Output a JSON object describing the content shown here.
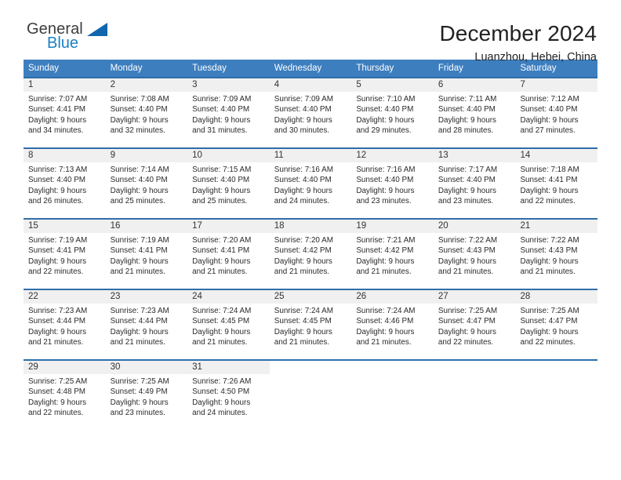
{
  "brand": {
    "name_part1": "General",
    "name_part2": "Blue",
    "triangle_icon": "triangle-icon",
    "color_dark": "#3c3c3c",
    "color_blue": "#1c7fc4",
    "triangle_color": "#1167ad"
  },
  "header": {
    "title": "December 2024",
    "subtitle": "Luanzhou, Hebei, China"
  },
  "theme": {
    "header_bg": "#3d7ebf",
    "header_text": "#ffffff",
    "row_separator": "#2f6ea8",
    "daynum_bg": "#f0f0f0",
    "body_text": "#2b2b2b"
  },
  "weekdays": [
    "Sunday",
    "Monday",
    "Tuesday",
    "Wednesday",
    "Thursday",
    "Friday",
    "Saturday"
  ],
  "weeks": [
    [
      {
        "day": "1",
        "sunrise": "Sunrise: 7:07 AM",
        "sunset": "Sunset: 4:41 PM",
        "daylight_line1": "Daylight: 9 hours",
        "daylight_line2": "and 34 minutes."
      },
      {
        "day": "2",
        "sunrise": "Sunrise: 7:08 AM",
        "sunset": "Sunset: 4:40 PM",
        "daylight_line1": "Daylight: 9 hours",
        "daylight_line2": "and 32 minutes."
      },
      {
        "day": "3",
        "sunrise": "Sunrise: 7:09 AM",
        "sunset": "Sunset: 4:40 PM",
        "daylight_line1": "Daylight: 9 hours",
        "daylight_line2": "and 31 minutes."
      },
      {
        "day": "4",
        "sunrise": "Sunrise: 7:09 AM",
        "sunset": "Sunset: 4:40 PM",
        "daylight_line1": "Daylight: 9 hours",
        "daylight_line2": "and 30 minutes."
      },
      {
        "day": "5",
        "sunrise": "Sunrise: 7:10 AM",
        "sunset": "Sunset: 4:40 PM",
        "daylight_line1": "Daylight: 9 hours",
        "daylight_line2": "and 29 minutes."
      },
      {
        "day": "6",
        "sunrise": "Sunrise: 7:11 AM",
        "sunset": "Sunset: 4:40 PM",
        "daylight_line1": "Daylight: 9 hours",
        "daylight_line2": "and 28 minutes."
      },
      {
        "day": "7",
        "sunrise": "Sunrise: 7:12 AM",
        "sunset": "Sunset: 4:40 PM",
        "daylight_line1": "Daylight: 9 hours",
        "daylight_line2": "and 27 minutes."
      }
    ],
    [
      {
        "day": "8",
        "sunrise": "Sunrise: 7:13 AM",
        "sunset": "Sunset: 4:40 PM",
        "daylight_line1": "Daylight: 9 hours",
        "daylight_line2": "and 26 minutes."
      },
      {
        "day": "9",
        "sunrise": "Sunrise: 7:14 AM",
        "sunset": "Sunset: 4:40 PM",
        "daylight_line1": "Daylight: 9 hours",
        "daylight_line2": "and 25 minutes."
      },
      {
        "day": "10",
        "sunrise": "Sunrise: 7:15 AM",
        "sunset": "Sunset: 4:40 PM",
        "daylight_line1": "Daylight: 9 hours",
        "daylight_line2": "and 25 minutes."
      },
      {
        "day": "11",
        "sunrise": "Sunrise: 7:16 AM",
        "sunset": "Sunset: 4:40 PM",
        "daylight_line1": "Daylight: 9 hours",
        "daylight_line2": "and 24 minutes."
      },
      {
        "day": "12",
        "sunrise": "Sunrise: 7:16 AM",
        "sunset": "Sunset: 4:40 PM",
        "daylight_line1": "Daylight: 9 hours",
        "daylight_line2": "and 23 minutes."
      },
      {
        "day": "13",
        "sunrise": "Sunrise: 7:17 AM",
        "sunset": "Sunset: 4:40 PM",
        "daylight_line1": "Daylight: 9 hours",
        "daylight_line2": "and 23 minutes."
      },
      {
        "day": "14",
        "sunrise": "Sunrise: 7:18 AM",
        "sunset": "Sunset: 4:41 PM",
        "daylight_line1": "Daylight: 9 hours",
        "daylight_line2": "and 22 minutes."
      }
    ],
    [
      {
        "day": "15",
        "sunrise": "Sunrise: 7:19 AM",
        "sunset": "Sunset: 4:41 PM",
        "daylight_line1": "Daylight: 9 hours",
        "daylight_line2": "and 22 minutes."
      },
      {
        "day": "16",
        "sunrise": "Sunrise: 7:19 AM",
        "sunset": "Sunset: 4:41 PM",
        "daylight_line1": "Daylight: 9 hours",
        "daylight_line2": "and 21 minutes."
      },
      {
        "day": "17",
        "sunrise": "Sunrise: 7:20 AM",
        "sunset": "Sunset: 4:41 PM",
        "daylight_line1": "Daylight: 9 hours",
        "daylight_line2": "and 21 minutes."
      },
      {
        "day": "18",
        "sunrise": "Sunrise: 7:20 AM",
        "sunset": "Sunset: 4:42 PM",
        "daylight_line1": "Daylight: 9 hours",
        "daylight_line2": "and 21 minutes."
      },
      {
        "day": "19",
        "sunrise": "Sunrise: 7:21 AM",
        "sunset": "Sunset: 4:42 PM",
        "daylight_line1": "Daylight: 9 hours",
        "daylight_line2": "and 21 minutes."
      },
      {
        "day": "20",
        "sunrise": "Sunrise: 7:22 AM",
        "sunset": "Sunset: 4:43 PM",
        "daylight_line1": "Daylight: 9 hours",
        "daylight_line2": "and 21 minutes."
      },
      {
        "day": "21",
        "sunrise": "Sunrise: 7:22 AM",
        "sunset": "Sunset: 4:43 PM",
        "daylight_line1": "Daylight: 9 hours",
        "daylight_line2": "and 21 minutes."
      }
    ],
    [
      {
        "day": "22",
        "sunrise": "Sunrise: 7:23 AM",
        "sunset": "Sunset: 4:44 PM",
        "daylight_line1": "Daylight: 9 hours",
        "daylight_line2": "and 21 minutes."
      },
      {
        "day": "23",
        "sunrise": "Sunrise: 7:23 AM",
        "sunset": "Sunset: 4:44 PM",
        "daylight_line1": "Daylight: 9 hours",
        "daylight_line2": "and 21 minutes."
      },
      {
        "day": "24",
        "sunrise": "Sunrise: 7:24 AM",
        "sunset": "Sunset: 4:45 PM",
        "daylight_line1": "Daylight: 9 hours",
        "daylight_line2": "and 21 minutes."
      },
      {
        "day": "25",
        "sunrise": "Sunrise: 7:24 AM",
        "sunset": "Sunset: 4:45 PM",
        "daylight_line1": "Daylight: 9 hours",
        "daylight_line2": "and 21 minutes."
      },
      {
        "day": "26",
        "sunrise": "Sunrise: 7:24 AM",
        "sunset": "Sunset: 4:46 PM",
        "daylight_line1": "Daylight: 9 hours",
        "daylight_line2": "and 21 minutes."
      },
      {
        "day": "27",
        "sunrise": "Sunrise: 7:25 AM",
        "sunset": "Sunset: 4:47 PM",
        "daylight_line1": "Daylight: 9 hours",
        "daylight_line2": "and 22 minutes."
      },
      {
        "day": "28",
        "sunrise": "Sunrise: 7:25 AM",
        "sunset": "Sunset: 4:47 PM",
        "daylight_line1": "Daylight: 9 hours",
        "daylight_line2": "and 22 minutes."
      }
    ],
    [
      {
        "day": "29",
        "sunrise": "Sunrise: 7:25 AM",
        "sunset": "Sunset: 4:48 PM",
        "daylight_line1": "Daylight: 9 hours",
        "daylight_line2": "and 22 minutes."
      },
      {
        "day": "30",
        "sunrise": "Sunrise: 7:25 AM",
        "sunset": "Sunset: 4:49 PM",
        "daylight_line1": "Daylight: 9 hours",
        "daylight_line2": "and 23 minutes."
      },
      {
        "day": "31",
        "sunrise": "Sunrise: 7:26 AM",
        "sunset": "Sunset: 4:50 PM",
        "daylight_line1": "Daylight: 9 hours",
        "daylight_line2": "and 24 minutes."
      },
      {
        "day": "",
        "sunrise": "",
        "sunset": "",
        "daylight_line1": "",
        "daylight_line2": ""
      },
      {
        "day": "",
        "sunrise": "",
        "sunset": "",
        "daylight_line1": "",
        "daylight_line2": ""
      },
      {
        "day": "",
        "sunrise": "",
        "sunset": "",
        "daylight_line1": "",
        "daylight_line2": ""
      },
      {
        "day": "",
        "sunrise": "",
        "sunset": "",
        "daylight_line1": "",
        "daylight_line2": ""
      }
    ]
  ]
}
